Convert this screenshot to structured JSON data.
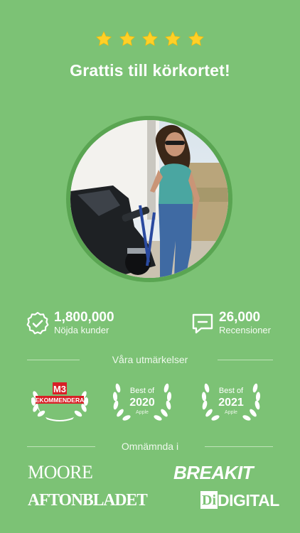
{
  "rating": {
    "stars": 5,
    "star_color": "#ffd027"
  },
  "headline": "Grattis till körkortet!",
  "stats": [
    {
      "icon": "verified-badge-icon",
      "value": "1,800,000",
      "label": "Nöjda kunder"
    },
    {
      "icon": "speech-bubble-icon",
      "value": "26,000",
      "label": "Recensioner"
    }
  ],
  "awards_heading": "Våra utmärkelser",
  "awards": [
    {
      "icon": "laurel-wreath-icon",
      "badge": "M3",
      "text": "REKOMMENDERAR"
    },
    {
      "icon": "laurel-wreath-icon",
      "top": "Best of",
      "year": "2020",
      "brand": "Apple"
    },
    {
      "icon": "laurel-wreath-icon",
      "top": "Best of",
      "year": "2021",
      "brand": "Apple"
    }
  ],
  "press_heading": "Omnämnda i",
  "press": [
    "MOORE",
    "BREAKIT",
    "AFTONBLADET",
    "DIGITAL",
    "Di"
  ],
  "colors": {
    "background": "#7cc275",
    "ring": "#5aa552",
    "badge_red": "#d81f26"
  }
}
